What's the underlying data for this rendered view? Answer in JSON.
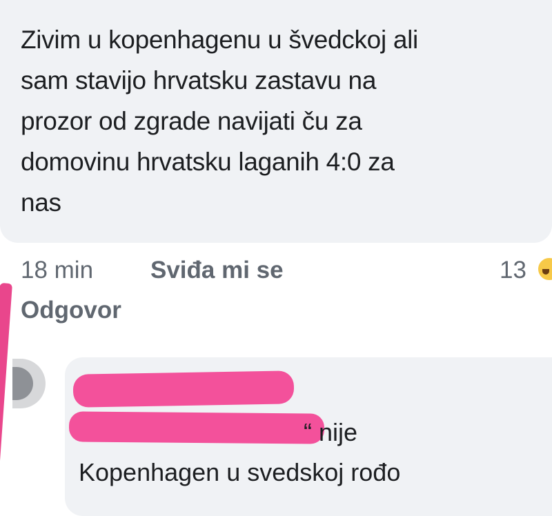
{
  "comment": {
    "text": "Zivim u kopenhagenu u švedckoj ali\nsam stavijo hrvatsku zastavu na\nprozor od zgrade navijati ču za\ndomovinu hrvatsku laganih 4:0 za\nnas"
  },
  "actions": {
    "time": "18 min",
    "like": "Sviđa mi se",
    "reply": "Odgovor",
    "reaction_count": "13"
  },
  "reply_comment": {
    "mention_suffix": "“ nije",
    "text": "Kopenhagen u svedskoj rođo"
  },
  "colors": {
    "bubble": "#f0f2f5",
    "redaction": "#f3519b",
    "action_text": "#606770"
  }
}
